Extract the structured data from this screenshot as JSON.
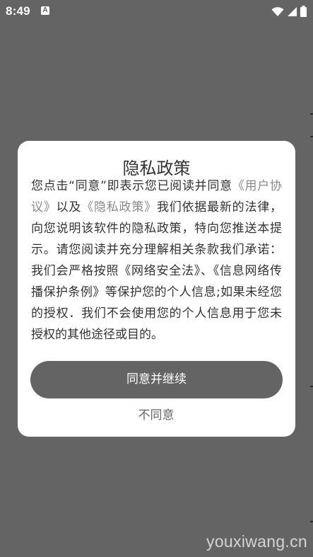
{
  "status_bar": {
    "time": "8:49",
    "notification_badge": "A",
    "icons": [
      "wifi-icon",
      "signal-icon",
      "battery-icon"
    ]
  },
  "dialog": {
    "title": "隐私政策",
    "body": {
      "part1": "您点击“同意”即表示您已阅读并同意",
      "link1": "《用户协议》",
      "part2": "以及",
      "link2": "《隐私政策》",
      "part3": "我们依据最新的法律，向您说明该软件的隐私政策，特向您推送本提示。请您阅读并充分理解相关条款我们承诺：我们会严格按照《网络安全法》、《信息网络传播保护条例》等保护您的个人信息;如果未经您的授权．我们不会使用您的个人信息用于您未授权的其他途径或目的。"
    },
    "agree_label": "同意并继续",
    "disagree_label": "不同意"
  },
  "watermark": "youxiwang.cn",
  "colors": {
    "overlay": "#646464",
    "dialog_bg": "#ffffff",
    "primary_button": "#646464",
    "link_text": "#8a8a8a",
    "body_text": "#333333"
  }
}
